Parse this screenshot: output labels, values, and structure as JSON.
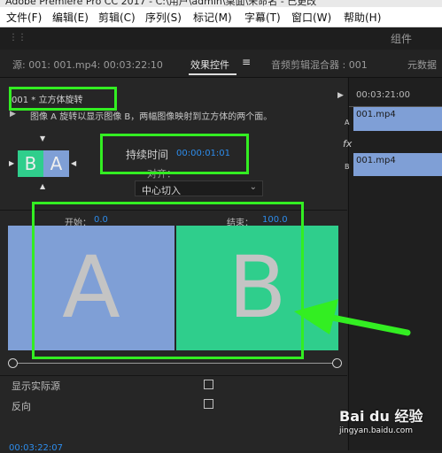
{
  "window": {
    "title": "Adobe Premiere Pro CC 2017 - C:\\用户\\admin\\桌面\\未命名 - 已更改"
  },
  "menu": [
    "文件(F)",
    "编辑(E)",
    "剪辑(C)",
    "序列(S)",
    "标记(M)",
    "字幕(T)",
    "窗口(W)",
    "帮助(H)"
  ],
  "toolbar": {
    "group_label": "组件"
  },
  "tabs": {
    "source": "源: 001: 001.mp4: 00:03:22:10",
    "effect_controls": "效果控件",
    "menu_glyph": "≡",
    "audio_mixer": "音频剪辑混合器 : 001",
    "metadata": "元数据"
  },
  "effect": {
    "name": "001 * 立方体旋转",
    "description": "图像 A 旋转以显示图像 B，两幅图像映射到立方体的两个面。",
    "thumb_a": "A",
    "thumb_b": "B",
    "duration_label": "持续时间",
    "duration_value": "00:00:01:01",
    "align_label": "对齐：",
    "align_value": "中心切入",
    "start_label": "开始：",
    "start_value": "0.0",
    "end_label": "结束：",
    "end_value": "100.0",
    "preview_a": "A",
    "preview_b": "B",
    "show_actual_sources_label": "显示实际源",
    "reverse_label": "反向"
  },
  "timeline": {
    "timecode": "00:03:21:00",
    "track_a_label": "A",
    "track_b_label": "B",
    "fx_label": "fx",
    "clip_a": "001.mp4",
    "clip_b": "001.mp4"
  },
  "footer": {
    "timecode": "00:03:22:07"
  },
  "watermark": {
    "brand": "Bai du 经验",
    "url": "jingyan.baidu.com"
  },
  "colors": {
    "blue_a": "#7f9fd6",
    "green_b": "#2fce8c",
    "accent": "#2d8ceb",
    "annotation": "#33ee22"
  }
}
